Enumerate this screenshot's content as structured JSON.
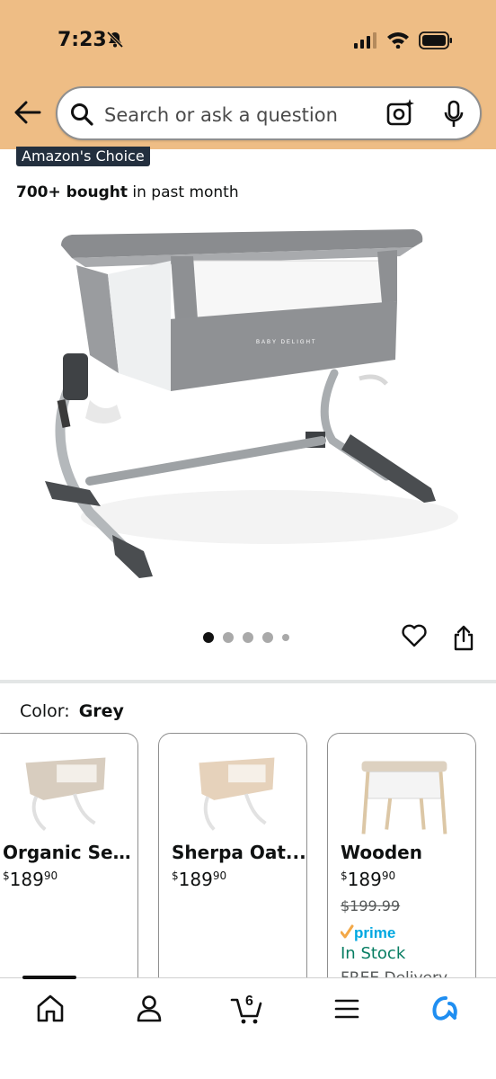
{
  "status_bar": {
    "time": "7:23"
  },
  "search": {
    "placeholder": "Search or ask a question"
  },
  "product": {
    "badge": "Amazon's Choice",
    "bought_bold": "700+ bought",
    "bought_rest": " in past month",
    "brand_mark": "BABY DELIGHT",
    "carousel": {
      "total": 5,
      "current": 1
    }
  },
  "color": {
    "label": "Color:",
    "value": "Grey"
  },
  "variants": [
    {
      "name": "Organic Ses...",
      "price_whole": "189",
      "price_fraction": "90",
      "currency": "$"
    },
    {
      "name": "Sherpa Oat...",
      "price_whole": "189",
      "price_fraction": "90",
      "currency": "$"
    },
    {
      "name": "Wooden",
      "price_whole": "189",
      "price_fraction": "90",
      "currency": "$",
      "list_price": "$199.99",
      "prime": "prime",
      "stock": "In Stock",
      "delivery": "FREE Delivery"
    }
  ],
  "bottom_nav": {
    "cart_count": "6",
    "items": [
      "home-icon",
      "account-icon",
      "cart-icon",
      "menu-icon",
      "rufus-icon"
    ]
  },
  "colors": {
    "header_bg": "#eebd85",
    "prime_blue": "#00a8e1",
    "prime_check": "#f3a847",
    "stock_green": "#067d62",
    "rufus_blue": "#1f8ef1"
  }
}
